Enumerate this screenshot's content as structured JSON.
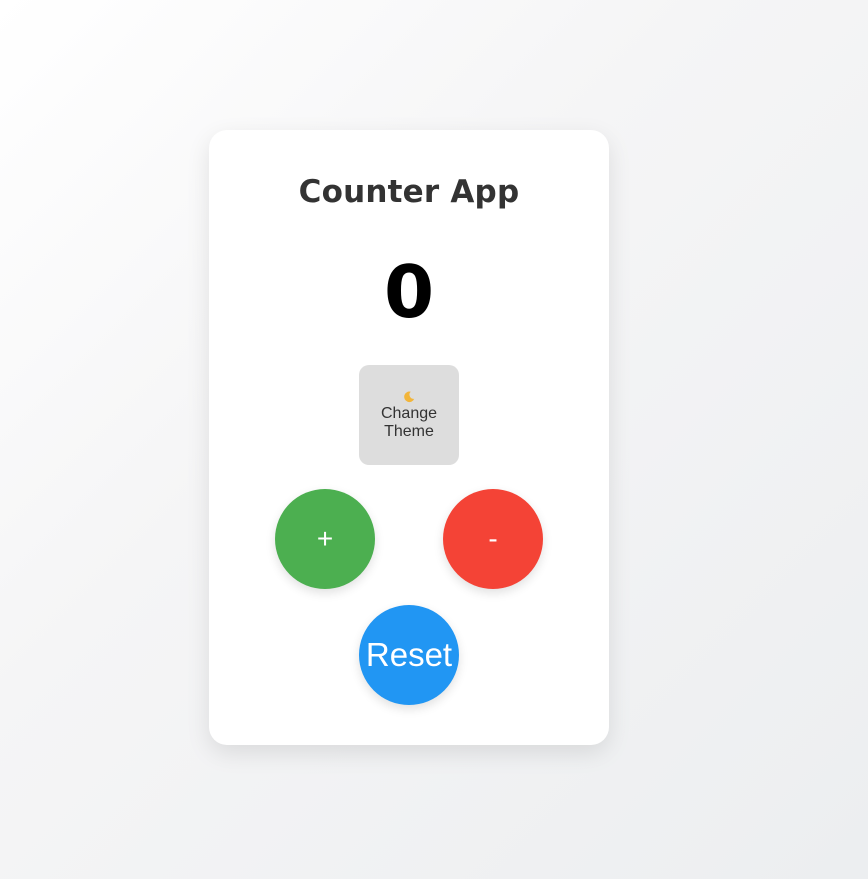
{
  "app": {
    "title": "Counter App",
    "count": "0"
  },
  "theme_button": {
    "icon": "moon-icon",
    "label": "Change Theme"
  },
  "buttons": {
    "increment_label": "+",
    "decrement_label": "-",
    "reset_label": "Reset"
  },
  "colors": {
    "increment": "#4caf50",
    "decrement": "#f44336",
    "reset": "#2196f3",
    "theme_button": "#dddddd",
    "moon": "#f2b53a"
  }
}
